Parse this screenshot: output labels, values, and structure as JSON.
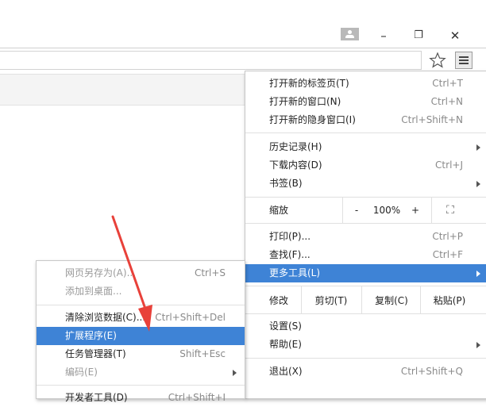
{
  "window": {
    "minimize": "–",
    "restore": "❐",
    "close": "✕"
  },
  "main_menu": {
    "new_tab": "打开新的标签页(T)",
    "new_tab_shortcut": "Ctrl+T",
    "new_window": "打开新的窗口(N)",
    "new_window_shortcut": "Ctrl+N",
    "incognito": "打开新的隐身窗口(I)",
    "incognito_shortcut": "Ctrl+Shift+N",
    "history": "历史记录(H)",
    "downloads": "下载内容(D)",
    "downloads_shortcut": "Ctrl+J",
    "bookmarks": "书签(B)",
    "zoom_label": "缩放",
    "zoom_out": "-",
    "zoom_value": "100%",
    "zoom_in": "+",
    "fullscreen": "⛶",
    "print": "打印(P)...",
    "print_shortcut": "Ctrl+P",
    "find": "查找(F)...",
    "find_shortcut": "Ctrl+F",
    "more_tools": "更多工具(L)",
    "edit_label": "修改",
    "cut": "剪切(T)",
    "copy": "复制(C)",
    "paste": "粘贴(P)",
    "settings": "设置(S)",
    "help": "帮助(E)",
    "exit": "退出(X)",
    "exit_shortcut": "Ctrl+Shift+Q"
  },
  "sub_menu": {
    "save_page": "网页另存为(A)...",
    "save_page_shortcut": "Ctrl+S",
    "add_to_desktop": "添加到桌面...",
    "clear_data": "清除浏览数据(C)...",
    "clear_data_shortcut": "Ctrl+Shift+Del",
    "extensions": "扩展程序(E)",
    "task_manager": "任务管理器(T)",
    "task_manager_shortcut": "Shift+Esc",
    "encoding": "编码(E)",
    "dev_tools": "开发者工具(D)",
    "dev_tools_shortcut": "Ctrl+Shift+I"
  },
  "colors": {
    "highlight": "#3e83d6",
    "arrow": "#e8413a"
  }
}
